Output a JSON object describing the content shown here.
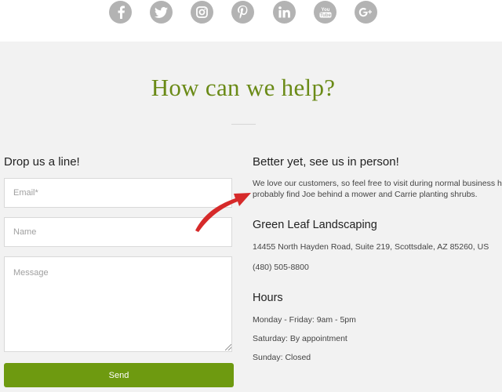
{
  "social": {
    "icons": [
      "facebook-icon",
      "twitter-icon",
      "instagram-icon",
      "pinterest-icon",
      "linkedin-icon",
      "youtube-icon",
      "google-plus-icon"
    ],
    "icon_color": "#b3b3b3"
  },
  "main": {
    "heading": "How can we help?",
    "heading_color": "#6a8a16"
  },
  "form": {
    "title": "Drop us a line!",
    "email_placeholder": "Email*",
    "name_placeholder": "Name",
    "message_placeholder": "Message",
    "send_label": "Send",
    "send_color": "#6e9a10"
  },
  "contact": {
    "title": "Better yet, see us in person!",
    "intro_line1": "We love our customers, so feel free to visit during normal business hours.",
    "intro_line2": "probably find Joe behind a mower and Carrie planting shrubs.",
    "company": "Green Leaf Landscaping",
    "address": "14455 North Hayden Road, Suite 219, Scottsdale, AZ 85260, US",
    "phone": "(480) 505-8800",
    "hours_title": "Hours",
    "hours": [
      "Monday - Friday: 9am - 5pm",
      "Saturday: By appointment",
      "Sunday: Closed"
    ]
  },
  "annotation": {
    "arrow_color": "#d62a2a"
  }
}
